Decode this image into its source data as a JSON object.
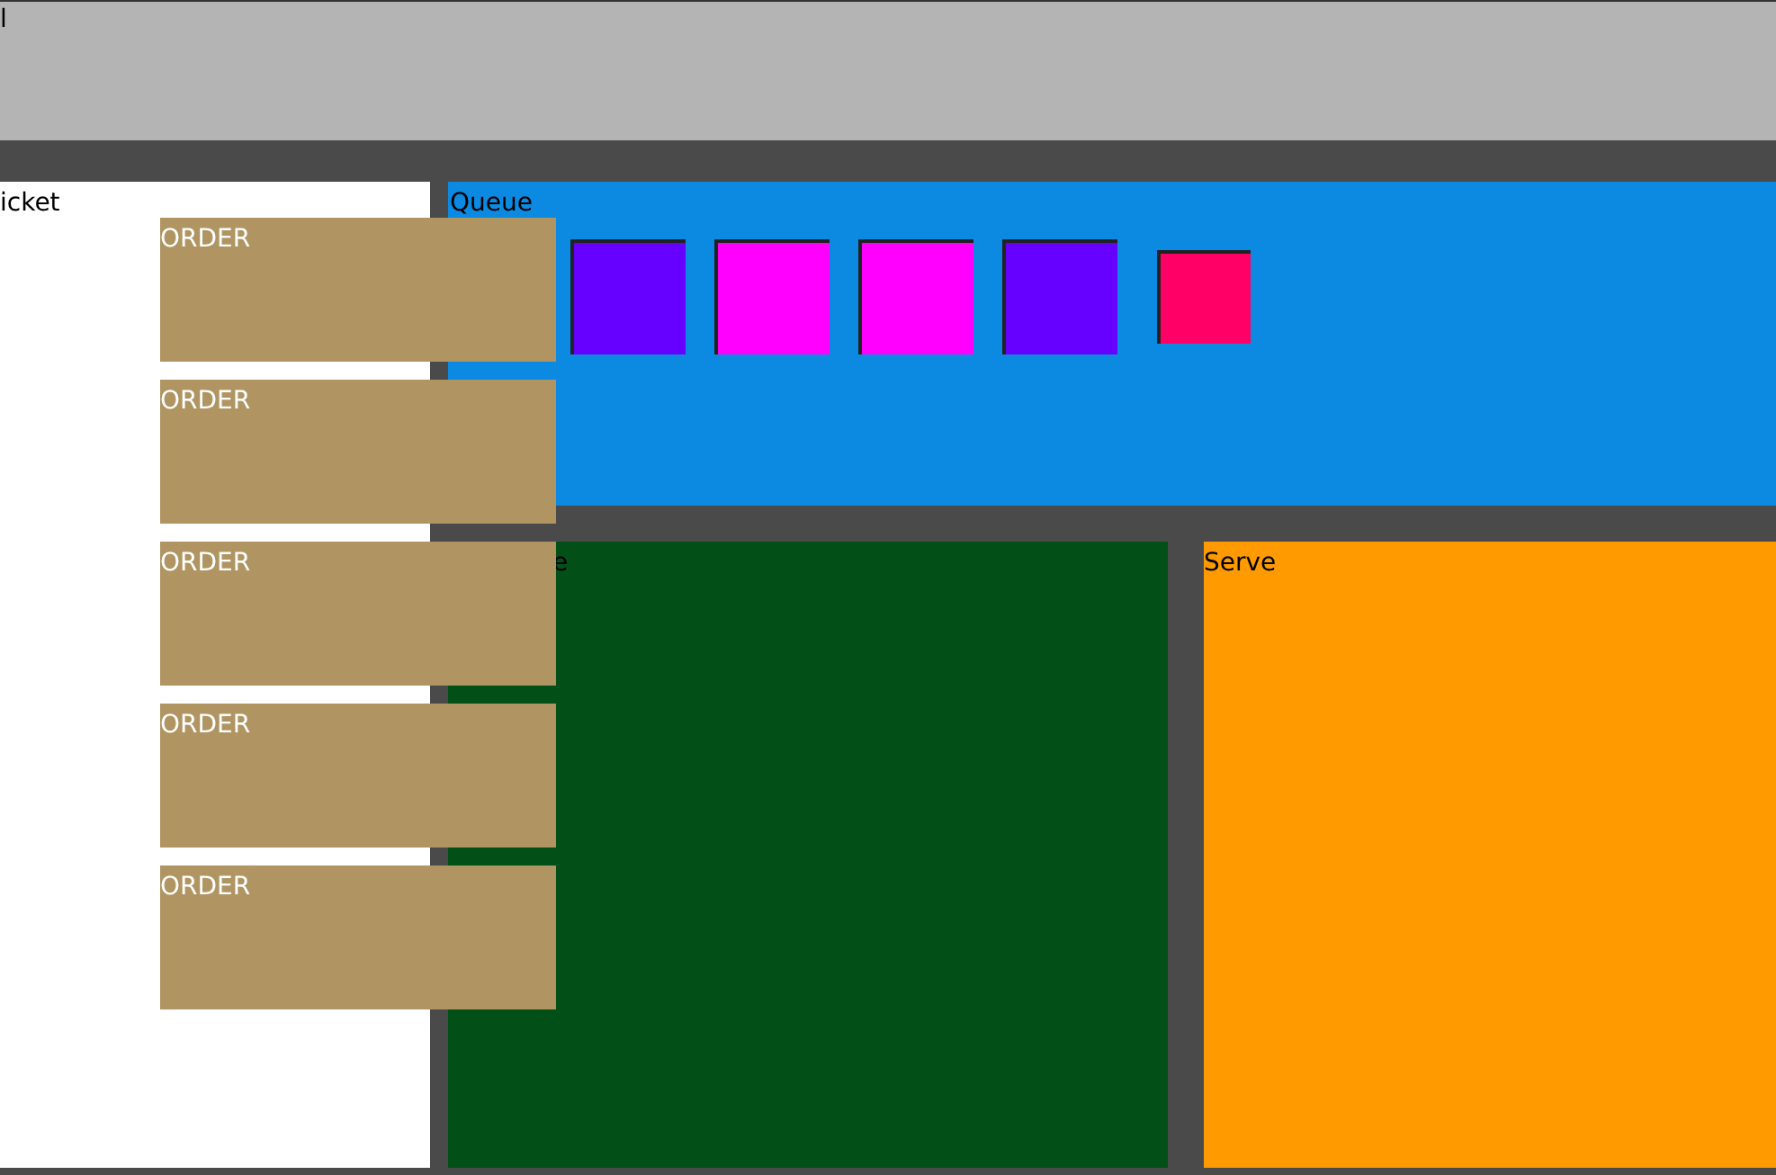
{
  "header": {
    "title": "l"
  },
  "ticket": {
    "title": "icket"
  },
  "queue": {
    "title": "Queue",
    "items": [
      {
        "kind": "large",
        "color": "#6600ff"
      },
      {
        "kind": "large",
        "color": "#ff00ff"
      },
      {
        "kind": "large",
        "color": "#ff00ff"
      },
      {
        "kind": "large",
        "color": "#6600ff"
      },
      {
        "kind": "small",
        "color": "#ff0066"
      }
    ]
  },
  "prepare": {
    "title": "e"
  },
  "serve": {
    "title": "Serve"
  },
  "orders": [
    {
      "label": "ORDER"
    },
    {
      "label": "ORDER"
    },
    {
      "label": "ORDER"
    },
    {
      "label": "ORDER"
    },
    {
      "label": "ORDER"
    }
  ]
}
